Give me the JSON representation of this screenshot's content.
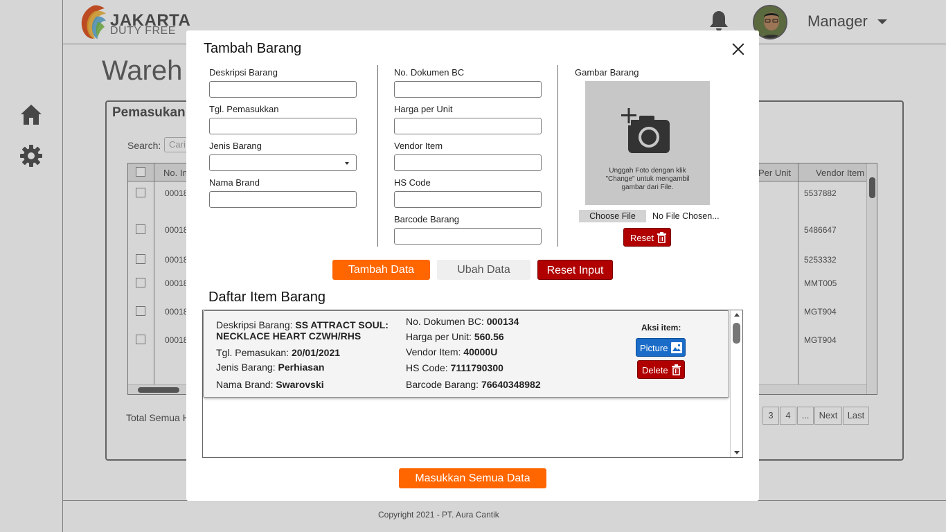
{
  "app": {
    "logo_line1": "JAKARTA",
    "logo_line2": "DUTY FREE",
    "user_name": "Manager",
    "page_title": "Wareh",
    "card_title": "Pemasukan",
    "search_label": "Search:",
    "search_placeholder": "Cari",
    "table_headers": [
      "No. Inc",
      "Per Unit",
      "Vendor Item"
    ],
    "table_rows": [
      {
        "no": "00018",
        "vendor": "5537882"
      },
      {
        "no": "00018",
        "vendor": "5486647"
      },
      {
        "no": "00018",
        "vendor": "5253332"
      },
      {
        "no": "00018",
        "vendor": "MMT005"
      },
      {
        "no": "00018",
        "vendor": "MGT904"
      },
      {
        "no": "00018",
        "vendor": "MGT904"
      }
    ],
    "total_label": "Total Semua H",
    "pager": [
      "3",
      "4",
      "...",
      "Next",
      "Last"
    ],
    "footer": "Copyright 2021 - PT. Aura Cantik"
  },
  "modal": {
    "title": "Tambah Barang",
    "col1": {
      "deskripsi_label": "Deskripsi Barang",
      "tgl_label": "Tgl. Pemasukkan",
      "jenis_label": "Jenis Barang",
      "brand_label": "Nama Brand"
    },
    "col2": {
      "dokumen_label": "No. Dokumen BC",
      "harga_label": "Harga per Unit",
      "vendor_label": "Vendor Item",
      "hs_label": "HS Code",
      "barcode_label": "Barcode Barang"
    },
    "image": {
      "label": "Gambar Barang",
      "hint": "Unggah Foto dengan klik \"Change\" untuk mengambil gambar dari File.",
      "choose_label": "Choose File",
      "no_file": "No File Chosen...",
      "reset_label": "Reset"
    },
    "buttons": {
      "tambah": "Tambah Data",
      "ubah": "Ubah Data",
      "reset_input": "Reset Input",
      "masukkan": "Masukkan Semua Data"
    },
    "list_title": "Daftar Item Barang",
    "item": {
      "deskripsi_label": "Deskripsi Barang:",
      "deskripsi_value": "SS ATTRACT SOUL: NECKLACE HEART CZWH/RHS",
      "tgl_label": "Tgl. Pemasukan:",
      "tgl_value": "20/01/2021",
      "jenis_label": "Jenis Barang:",
      "jenis_value": "Perhiasan",
      "brand_label": "Nama Brand:",
      "brand_value": "Swarovski",
      "dokumen_label": "No. Dokumen BC:",
      "dokumen_value": "000134",
      "harga_label": "Harga per Unit:",
      "harga_value": "560.56",
      "vendor_label": "Vendor Item:",
      "vendor_value": "40000U",
      "hs_label": "HS Code:",
      "hs_value": "7111790300",
      "barcode_label": "Barcode Barang:",
      "barcode_value": "76640348982",
      "aksi_label": "Aksi item:",
      "picture_label": "Picture",
      "delete_label": "Delete"
    }
  },
  "colors": {
    "orange": "#ff6600",
    "red": "#b00000",
    "blue": "#1a6cc8"
  }
}
